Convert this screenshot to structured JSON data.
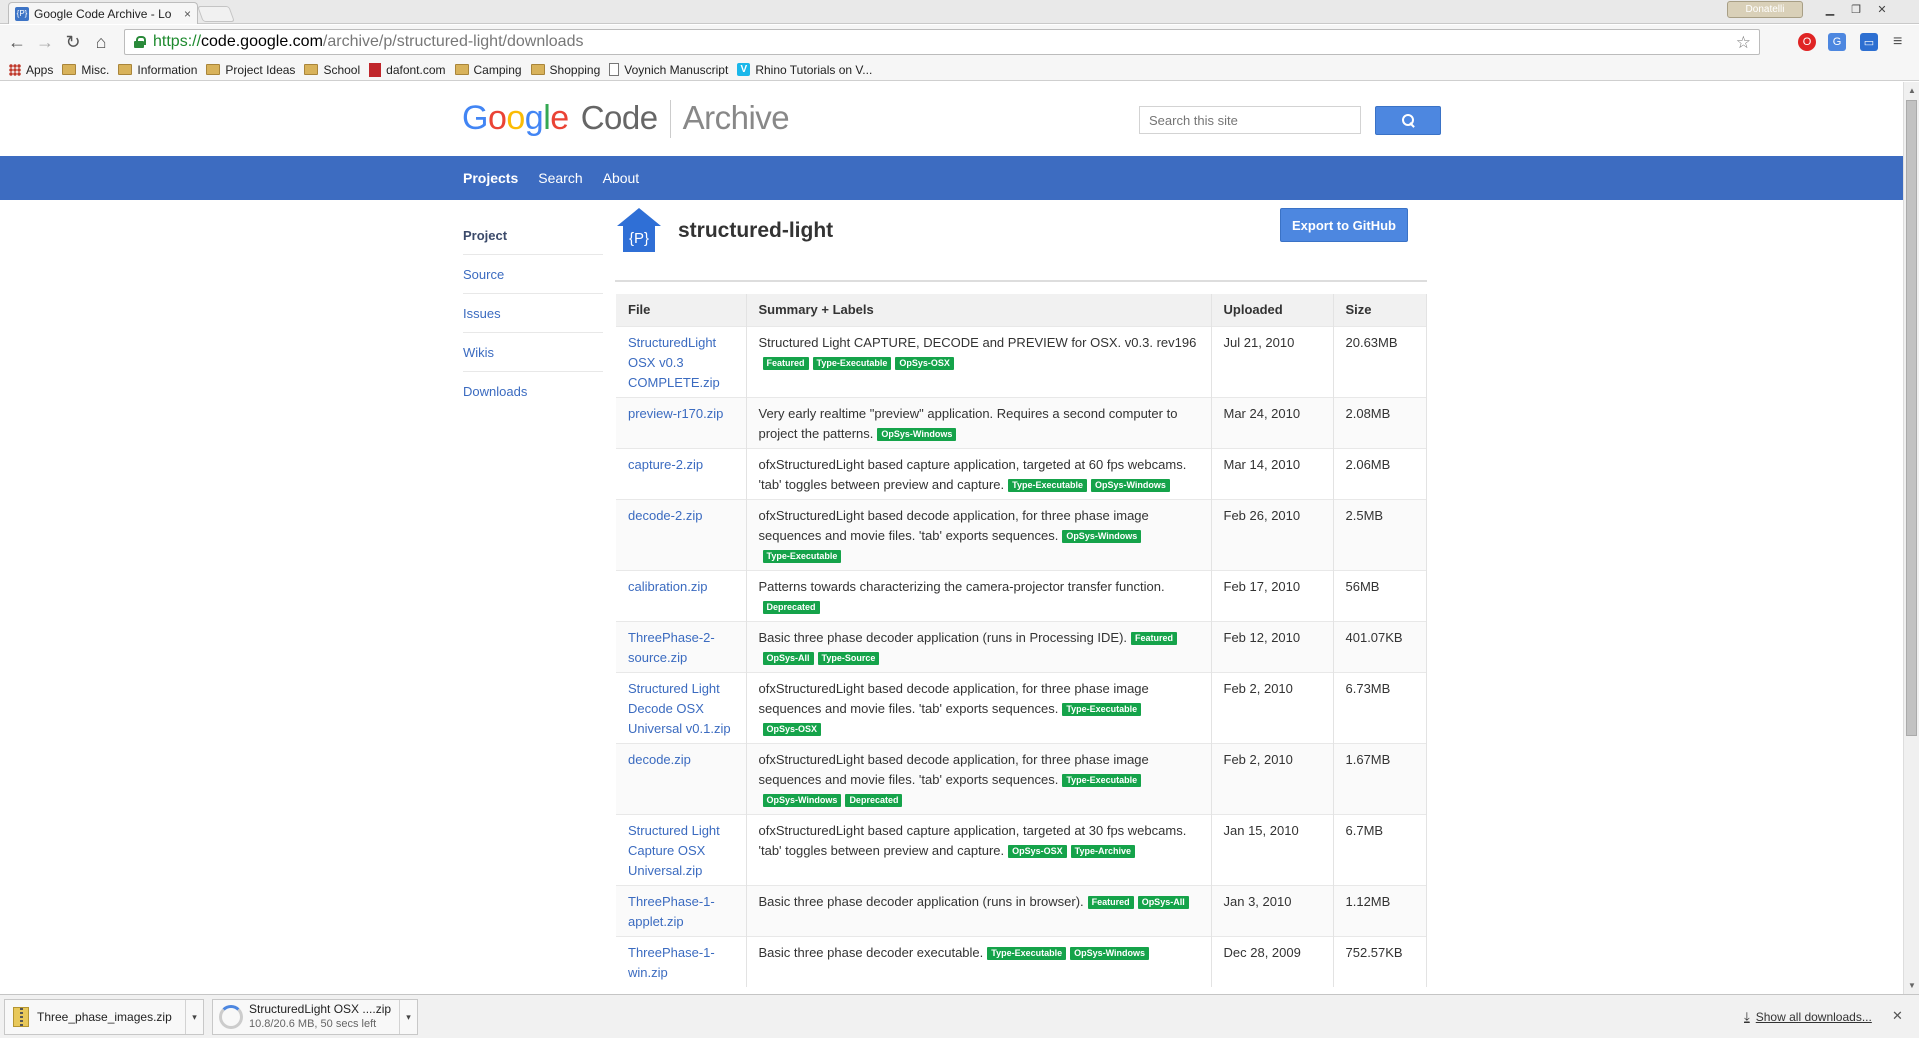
{
  "browser": {
    "tab_title": "Google Code Archive - Lo",
    "tab_favicon": "{P}",
    "tab_close": "×",
    "profile_name": "Donatelli",
    "url": {
      "scheme": "https://",
      "host": "code.google.com",
      "path": "/archive/p/structured-light/downloads"
    },
    "bookmarks": [
      {
        "label": "Apps",
        "icon": "apps-grid"
      },
      {
        "label": "Misc.",
        "icon": "folder"
      },
      {
        "label": "Information",
        "icon": "folder"
      },
      {
        "label": "Project Ideas",
        "icon": "folder"
      },
      {
        "label": "School",
        "icon": "folder"
      },
      {
        "label": "dafont.com",
        "icon": "dafont"
      },
      {
        "label": "Camping",
        "icon": "folder"
      },
      {
        "label": "Shopping",
        "icon": "folder"
      },
      {
        "label": "Voynich Manuscript",
        "icon": "page"
      },
      {
        "label": "Rhino Tutorials on V...",
        "icon": "vimeo",
        "icon_text": "V"
      }
    ]
  },
  "site": {
    "logo": {
      "g1": "G",
      "g2": "o",
      "g3": "o",
      "g4": "g",
      "g5": "l",
      "g6": "e",
      "code": "Code",
      "archive": "Archive"
    },
    "search_placeholder": "Search this site",
    "nav": [
      "Projects",
      "Search",
      "About"
    ],
    "sidebar": [
      "Project",
      "Source",
      "Issues",
      "Wikis",
      "Downloads"
    ],
    "project_name": "structured-light",
    "project_icon_text": "{P}",
    "export_button": "Export to GitHub",
    "accent_color": "#3d6cc1",
    "label_color": "#15a34a",
    "table": {
      "headers": [
        "File",
        "Summary + Labels",
        "Uploaded",
        "Size"
      ],
      "rows": [
        {
          "file": "StructuredLight OSX v0.3 COMPLETE.zip",
          "summary": "Structured Light CAPTURE, DECODE and PREVIEW for OSX. v0.3. rev196",
          "labels": [
            "Featured",
            "Type-Executable",
            "OpSys-OSX"
          ],
          "uploaded": "Jul 21, 2010",
          "size": "20.63MB"
        },
        {
          "file": "preview-r170.zip",
          "summary": "Very early realtime \"preview\" application. Requires a second computer to project the patterns.",
          "labels": [
            "OpSys-Windows"
          ],
          "uploaded": "Mar 24, 2010",
          "size": "2.08MB"
        },
        {
          "file": "capture-2.zip",
          "summary": "ofxStructuredLight based capture application, targeted at 60 fps webcams. 'tab' toggles between preview and capture.",
          "labels": [
            "Type-Executable",
            "OpSys-Windows"
          ],
          "uploaded": "Mar 14, 2010",
          "size": "2.06MB"
        },
        {
          "file": "decode-2.zip",
          "summary": "ofxStructuredLight based decode application, for three phase image sequences and movie files. 'tab' exports sequences.",
          "labels": [
            "OpSys-Windows",
            "Type-Executable"
          ],
          "uploaded": "Feb 26, 2010",
          "size": "2.5MB"
        },
        {
          "file": "calibration.zip",
          "summary": "Patterns towards characterizing the camera-projector transfer function.",
          "labels": [
            "Deprecated"
          ],
          "uploaded": "Feb 17, 2010",
          "size": "56MB"
        },
        {
          "file": "ThreePhase-2-source.zip",
          "summary": "Basic three phase decoder application (runs in Processing IDE).",
          "labels": [
            "Featured",
            "OpSys-All",
            "Type-Source"
          ],
          "uploaded": "Feb 12, 2010",
          "size": "401.07KB"
        },
        {
          "file": "Structured Light Decode OSX Universal v0.1.zip",
          "summary": "ofxStructuredLight based decode application, for three phase image sequences and movie files. 'tab' exports sequences.",
          "labels": [
            "Type-Executable",
            "OpSys-OSX"
          ],
          "uploaded": "Feb 2, 2010",
          "size": "6.73MB"
        },
        {
          "file": "decode.zip",
          "summary": "ofxStructuredLight based decode application, for three phase image sequences and movie files. 'tab' exports sequences.",
          "labels": [
            "Type-Executable",
            "OpSys-Windows",
            "Deprecated"
          ],
          "uploaded": "Feb 2, 2010",
          "size": "1.67MB"
        },
        {
          "file": "Structured Light Capture OSX Universal.zip",
          "summary": "ofxStructuredLight based capture application, targeted at 30 fps webcams. 'tab' toggles between preview and capture.",
          "labels": [
            "OpSys-OSX",
            "Type-Archive"
          ],
          "uploaded": "Jan 15, 2010",
          "size": "6.7MB"
        },
        {
          "file": "ThreePhase-1-applet.zip",
          "summary": "Basic three phase decoder application (runs in browser).",
          "labels": [
            "Featured",
            "OpSys-All"
          ],
          "uploaded": "Jan 3, 2010",
          "size": "1.12MB"
        },
        {
          "file": "ThreePhase-1-win.zip",
          "summary": "Basic three phase decoder executable.",
          "labels": [
            "Type-Executable",
            "OpSys-Windows"
          ],
          "uploaded": "Dec 28, 2009",
          "size": "752.57KB"
        }
      ]
    }
  },
  "downloads": {
    "items": [
      {
        "name": "Three_phase_images.zip",
        "status": ""
      },
      {
        "name": "StructuredLight OSX ....zip",
        "status": "10.8/20.6 MB, 50 secs left"
      }
    ],
    "show_all": "Show all downloads..."
  }
}
